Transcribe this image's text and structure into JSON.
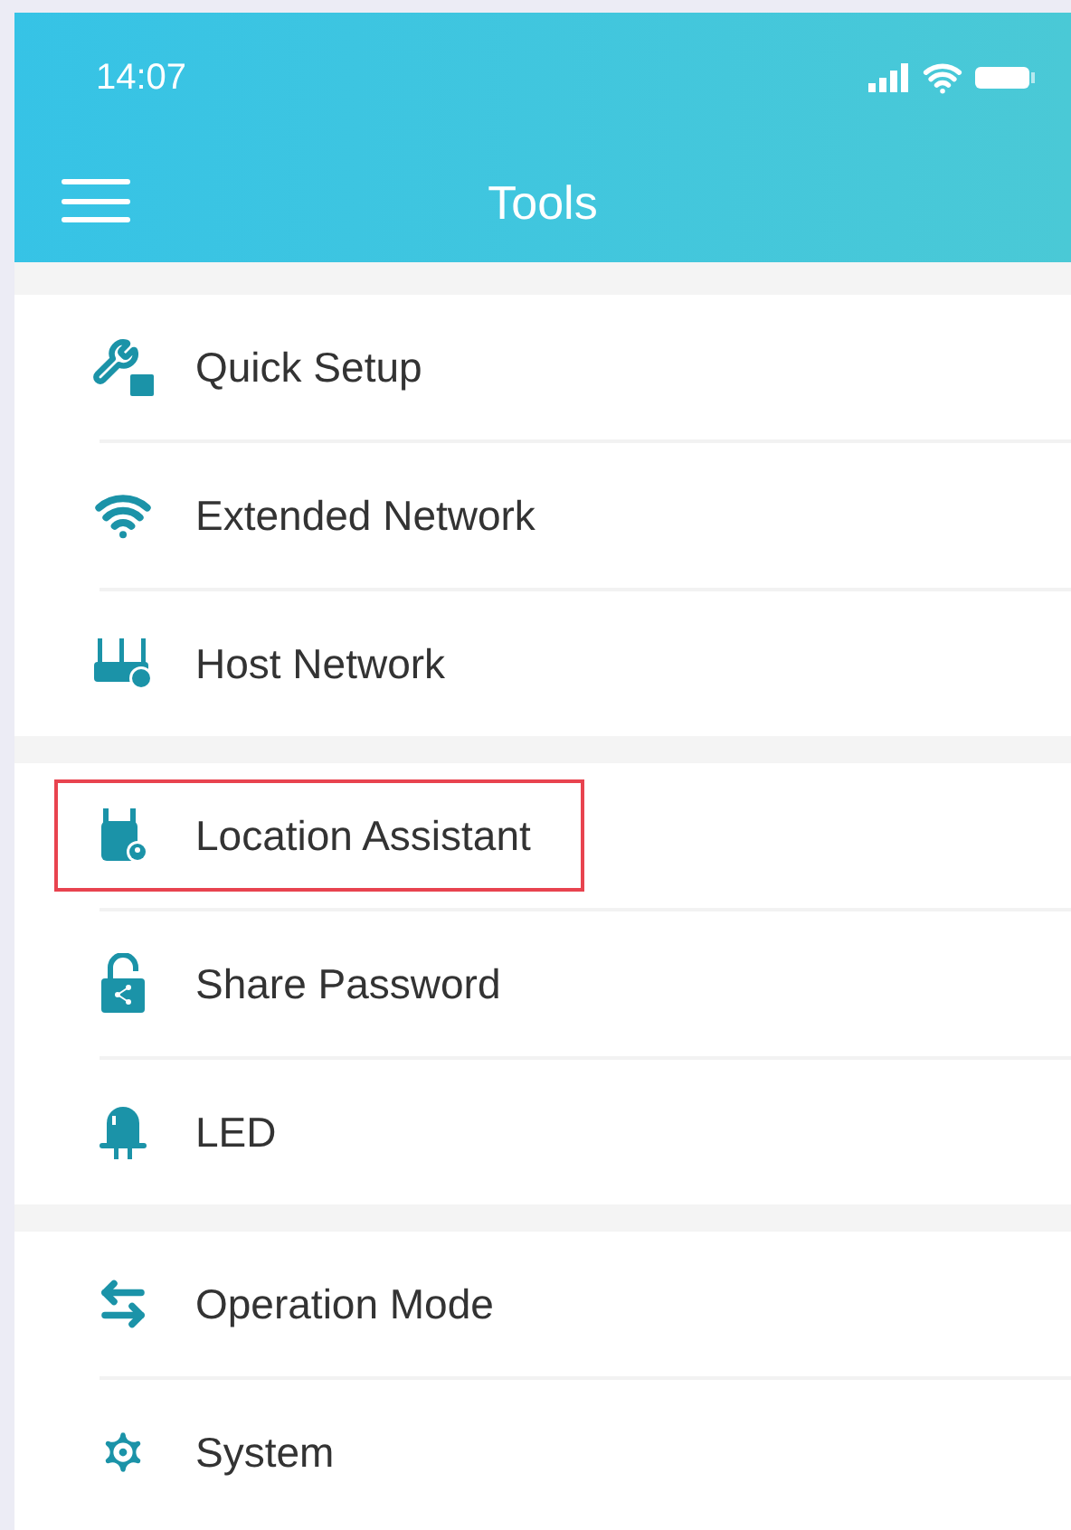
{
  "status_bar": {
    "time": "14:07"
  },
  "header": {
    "title": "Tools"
  },
  "groups": [
    {
      "items": [
        {
          "label": "Quick Setup",
          "highlighted": false
        },
        {
          "label": "Extended Network",
          "highlighted": false
        },
        {
          "label": "Host Network",
          "highlighted": false
        }
      ]
    },
    {
      "items": [
        {
          "label": "Location Assistant",
          "highlighted": true
        },
        {
          "label": "Share Password",
          "highlighted": false
        },
        {
          "label": "LED",
          "highlighted": false
        }
      ]
    },
    {
      "items": [
        {
          "label": "Operation Mode",
          "highlighted": false
        },
        {
          "label": "System",
          "highlighted": false
        }
      ]
    }
  ]
}
